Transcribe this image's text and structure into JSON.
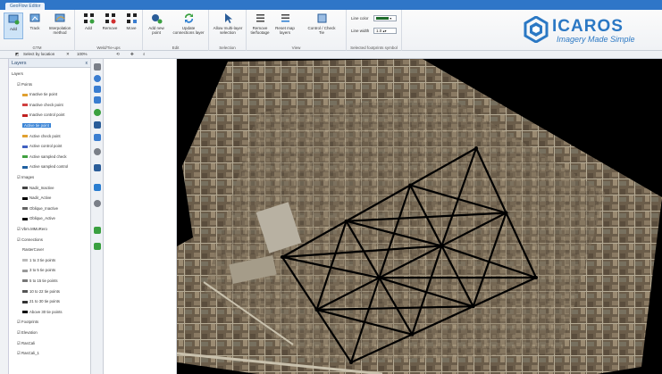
{
  "titlebar": {
    "tab_label": "GeoFlow Editor"
  },
  "ribbon": {
    "groups": [
      {
        "label": "GTM",
        "buttons": [
          "Add",
          "Track",
          "Interpolation method"
        ]
      },
      {
        "label": "Weld/Tie-ups",
        "buttons": [
          "Add",
          "Remove",
          "Move"
        ]
      },
      {
        "label": "Edit",
        "buttons": [
          "Add new point",
          "Update connections layer"
        ]
      },
      {
        "label": "Selection",
        "buttons": [
          "Allow multi-layer selection"
        ]
      },
      {
        "label": "View",
        "buttons": [
          "Remove tie/footage",
          "Reset map layers",
          "Control / Check",
          "Tie"
        ]
      },
      {
        "label": "Selected footprints symbol",
        "buttons": []
      }
    ],
    "line_color_label": "Line color",
    "line_width_label": "Line width",
    "line_width_value": "1.0"
  },
  "logo": {
    "brand": "ICAROS",
    "tagline": "Imagery Made Simple"
  },
  "toolbar2": {
    "select_by_location": "Select by location",
    "zoom_value": "100%"
  },
  "layers": {
    "title": "Layers",
    "close": "x",
    "items": [
      {
        "text": "Layers",
        "indent": 0
      },
      {
        "text": "Points",
        "indent": 1
      },
      {
        "text": "Inactive tie point",
        "indent": 2,
        "swatch": "#e0a030"
      },
      {
        "text": "Inactive check point",
        "indent": 2,
        "swatch": "#d04040"
      },
      {
        "text": "Inactive control point",
        "indent": 2,
        "swatch": "#c02020"
      },
      {
        "text": "Active tie point",
        "indent": 2,
        "selected": true
      },
      {
        "text": "Active check point",
        "indent": 2,
        "swatch": "#e0a030"
      },
      {
        "text": "Active control point",
        "indent": 2,
        "swatch": "#4060c0"
      },
      {
        "text": "Active sampled check",
        "indent": 2,
        "swatch": "#40a040"
      },
      {
        "text": "Active sampled control",
        "indent": 2,
        "swatch": "#2060a0"
      },
      {
        "text": "Images",
        "indent": 1
      },
      {
        "text": "Nadir_Inactive",
        "indent": 2,
        "swatch": "#444"
      },
      {
        "text": "Nadir_Active",
        "indent": 2,
        "swatch": "#000"
      },
      {
        "text": "Oblique_Inactive",
        "indent": 2,
        "swatch": "#666"
      },
      {
        "text": "Oblique_Active",
        "indent": 2,
        "swatch": "#111"
      },
      {
        "text": "Vbm.MMoRero",
        "indent": 1
      },
      {
        "text": "Connections",
        "indent": 1
      },
      {
        "text": "RasterCover",
        "indent": 2
      },
      {
        "text": "1 to 3 tie points",
        "indent": 2,
        "swatch": "#bbb"
      },
      {
        "text": "3 to 5 tie points",
        "indent": 2,
        "swatch": "#999"
      },
      {
        "text": "5 to 15 tie points",
        "indent": 2,
        "swatch": "#777"
      },
      {
        "text": "10 to 22 tie points",
        "indent": 2,
        "swatch": "#555"
      },
      {
        "text": "21 to 30 tie points",
        "indent": 2,
        "swatch": "#333"
      },
      {
        "text": "Above 30 tie points",
        "indent": 2,
        "swatch": "#000"
      },
      {
        "text": "Footprints",
        "indent": 1
      },
      {
        "text": "Elevation",
        "indent": 1
      },
      {
        "text": "RasCali",
        "indent": 1
      },
      {
        "text": "RasCali_1",
        "indent": 1
      }
    ]
  },
  "colors": {
    "accent": "#2f76c8",
    "selection": "#3a84d6",
    "map_background": "#000000",
    "tie_line": "#000000"
  }
}
